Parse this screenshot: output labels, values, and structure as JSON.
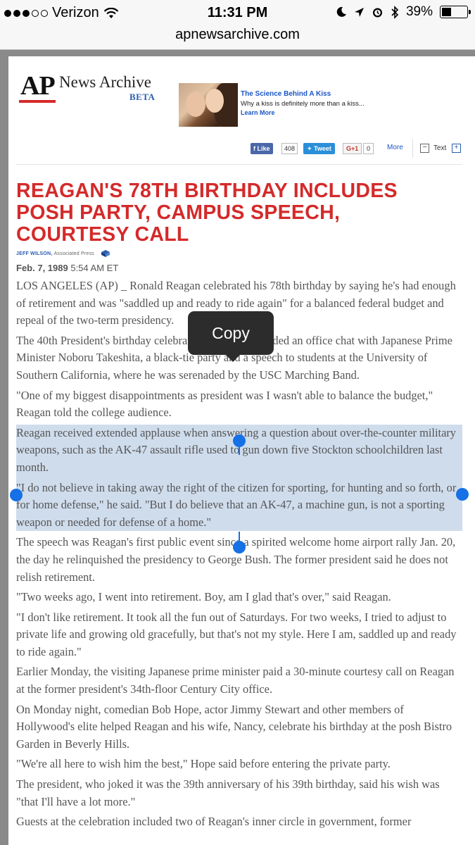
{
  "status_bar": {
    "carrier": "Verizon",
    "time": "11:31 PM",
    "battery": "39%",
    "battery_level": 0.39
  },
  "browser": {
    "url": "apnewsarchive.com"
  },
  "header": {
    "logo": "AP",
    "site_name": "News Archive",
    "beta": "BETA",
    "accent_color": "#d42a2a"
  },
  "ad": {
    "title": "The Science Behind A Kiss",
    "description": "Why a kiss is definitely more than a kiss...",
    "link": "Learn More"
  },
  "share_bar": {
    "like_label": "Like",
    "like_count": "408",
    "tweet_label": "Tweet",
    "gplus_label": "G+1",
    "gplus_count": "0",
    "more_label": "More",
    "text_label": "Text",
    "minus": "−",
    "plus": "+"
  },
  "article": {
    "headline": "REAGAN'S 78TH BIRTHDAY INCLUDES POSH PARTY, CAMPUS SPEECH, COURTESY CALL",
    "author": "JEFF WILSON,",
    "agency": "Associated Press",
    "date": "Feb. 7, 1989",
    "time": "5:54 AM ET",
    "paragraphs": [
      "LOS ANGELES (AP) _ Ronald Reagan celebrated his 78th birthday by saying he's had enough of retirement and was \"saddled up and ready to ride again\" for a balanced federal budget and repeal of the two-term presidency.",
      "The 40th President's birthday celebration Monday included an office chat with Japanese Prime Minister Noboru Takeshita, a black-tie party and a speech to students at the University of Southern California, where he was serenaded by the USC Marching Band.",
      "\"One of my biggest disappointments as president was I wasn't able to balance the budget,\" Reagan told the college audience.",
      "Reagan received extended applause when answering a question about over-the-counter military weapons, such as the AK-47 assault rifle used to gun down five Stockton schoolchildren last month.",
      "\"I do not believe in taking away the right of the citizen for sporting, for hunting and so forth, or for home defense,\" he said. \"But I do believe that an AK-47, a machine gun, is not a sporting weapon or needed for defense of a home.\"",
      "The speech was Reagan's first public event since a spirited welcome home airport rally Jan. 20, the day he relinquished the presidency to George Bush. The former president said he does not relish retirement.",
      "\"Two weeks ago, I went into retirement. Boy, am I glad that's over,\" said Reagan.",
      "\"I don't like retirement. It took all the fun out of Saturdays. For two weeks, I tried to adjust to private life and growing old gracefully, but that's not my style. Here I am, saddled up and ready to ride again.\"",
      "Earlier Monday, the visiting Japanese prime minister paid a 30-minute courtesy call on Reagan at the former president's 34th-floor Century City office.",
      "On Monday night, comedian Bob Hope, actor Jimmy Stewart and other members of Hollywood's elite helped Reagan and his wife, Nancy, celebrate his birthday at the posh Bistro Garden in Beverly Hills.",
      "\"We're all here to wish him the best,\" Hope said before entering the private party.",
      "The president, who joked it was the 39th anniversary of his 39th birthday, said his wish was \"that I'll have a lot more.\"",
      "Guests at the celebration included two of Reagan's inner circle in government, former"
    ]
  },
  "context_menu": {
    "copy_label": "Copy"
  },
  "selection_color": "#1670e6"
}
